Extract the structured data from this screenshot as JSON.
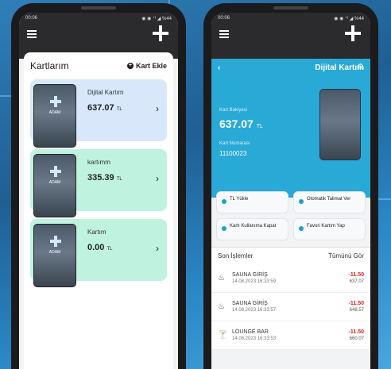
{
  "left": {
    "status_time": "00:06",
    "status_right": "◉ ◉ ⁺ᴵ ◢ %44",
    "title": "Kartlarım",
    "add_label": "Kart Ekle",
    "cards": [
      {
        "name": "Dijital Kartım",
        "balance": "637.07",
        "currency": "TL"
      },
      {
        "name": "kartımm",
        "balance": "335.39",
        "currency": "TL"
      },
      {
        "name": "Kartım",
        "balance": "0.00",
        "currency": "TL"
      }
    ]
  },
  "right": {
    "status_time": "00:06",
    "status_right": "◉ ◉ ⁺ᴵ ◢ %44",
    "title": "Dijital Kartım",
    "balance_label": "Kart Bakiyesi",
    "balance": "637.07",
    "currency": "TL",
    "card_no_label": "Kart Numarası",
    "card_no": "11100023",
    "actions": [
      "TL Yükle",
      "Otomatik Talimat Ver",
      "Kartı Kullanıma Kapat",
      "Favori Kartım Yap"
    ],
    "recent_title": "Son İşlemler",
    "see_all": "Tümünü Gör",
    "transactions": [
      {
        "name": "SAUNA GİRİŞ",
        "date": "14.08.2023 16:33:59",
        "amount": "-11.50",
        "balance": "637.07"
      },
      {
        "name": "SAUNA GİRİŞ",
        "date": "14.08.2023 16:33:57",
        "amount": "-11.50",
        "balance": "648.57"
      },
      {
        "name": "LOUNGE BAR",
        "date": "14.08.2023 16:33:53",
        "amount": "-11.50",
        "balance": "660.07"
      }
    ]
  }
}
